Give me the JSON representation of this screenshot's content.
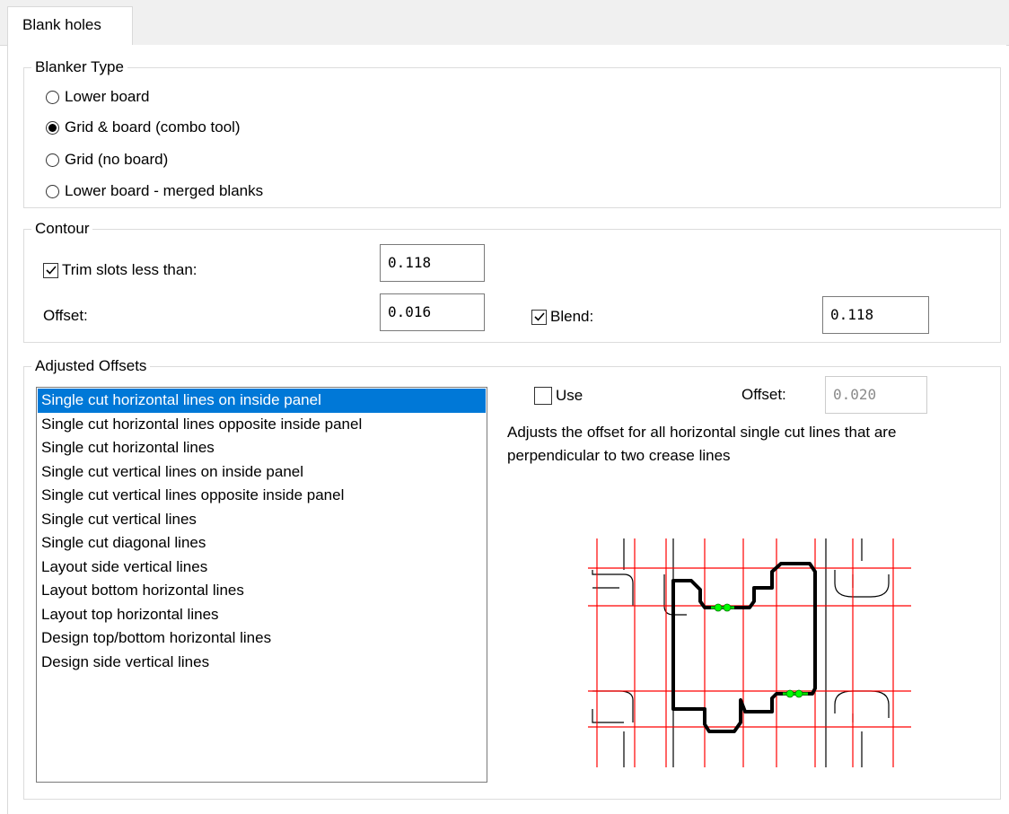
{
  "tabs": [
    {
      "label": "Blank holes",
      "active": true
    }
  ],
  "blanker_type": {
    "legend": "Blanker Type",
    "options": [
      {
        "label": "Lower board",
        "selected": false
      },
      {
        "label": "Grid & board (combo tool)",
        "selected": true
      },
      {
        "label": "Grid (no board)",
        "selected": false
      },
      {
        "label": "Lower board - merged blanks",
        "selected": false
      }
    ]
  },
  "contour": {
    "legend": "Contour",
    "trim_slots": {
      "label": "Trim slots less than:",
      "checked": true,
      "value": "0.118"
    },
    "offset": {
      "label": "Offset:",
      "value": "0.016"
    },
    "blend": {
      "label": "Blend:",
      "checked": true,
      "value": "0.118"
    }
  },
  "adjusted_offsets": {
    "legend": "Adjusted Offsets",
    "items": [
      "Single cut horizontal lines on inside panel",
      "Single cut horizontal lines opposite inside panel",
      "Single cut horizontal lines",
      "Single cut vertical lines on inside panel",
      "Single cut vertical lines opposite inside panel",
      "Single cut vertical lines",
      "Single cut diagonal lines",
      "Layout side vertical lines",
      "Layout bottom horizontal lines",
      "Layout top horizontal lines",
      "Design top/bottom horizontal lines",
      "Design side vertical lines"
    ],
    "selected_index": 0,
    "use": {
      "label": "Use",
      "checked": false
    },
    "offset_label": "Offset:",
    "offset_value": "0.020",
    "description": "Adjusts the offset for all horizontal single cut lines that are perpendicular to two crease lines"
  },
  "colors": {
    "selection": "#0078d7",
    "grid_line": "#ff0000",
    "marker": "#00ff00"
  }
}
